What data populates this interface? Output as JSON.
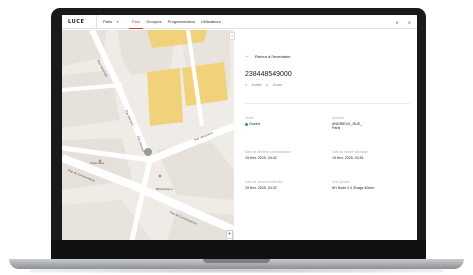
{
  "app": {
    "logo": "LUCE",
    "city": "Paris"
  },
  "nav": {
    "items": [
      "Parc",
      "Groupes",
      "Programmation",
      "Utilisateurs"
    ],
    "active": "Parc"
  },
  "topbar": {
    "lang": "fr",
    "user": "fr"
  },
  "map": {
    "labels": [
      "Rue Nationale",
      "Rue Barrault",
      "Rue Barrault",
      "Rue Vergniaud",
      "Rue du Conservatoire",
      "Rue de Conservatoire",
      "Pharmacie",
      "Bibliothèque"
    ],
    "zoom_in": "+",
    "zoom_out": "−"
  },
  "panel": {
    "back_label": "Retour à l'inventaire",
    "device_id": "238448549000",
    "meta": [
      "Installé",
      "Ouvert"
    ],
    "fields": [
      {
        "label": "Statut",
        "value": "Ouvert",
        "status_color": "#2ca94f"
      },
      {
        "label": "Adresse",
        "value": "ANDRIEUX_RUE_ Paris"
      },
      {
        "label": "Date de dernière communication",
        "value": "19 févr. 2025, 04:32"
      },
      {
        "label": "Date du dernier allumage",
        "value": "19 févr. 2025, 03:51"
      },
      {
        "label": "Date de dernière extinction",
        "value": "19 févr. 2025, 04:32"
      },
      {
        "label": "Suivi produit",
        "value": "8H Node 2.4 Zhaga 40mm"
      }
    ]
  },
  "colors": {
    "accent": "#c4473a",
    "building": "#f1d27a",
    "status_ok": "#2ca94f"
  }
}
